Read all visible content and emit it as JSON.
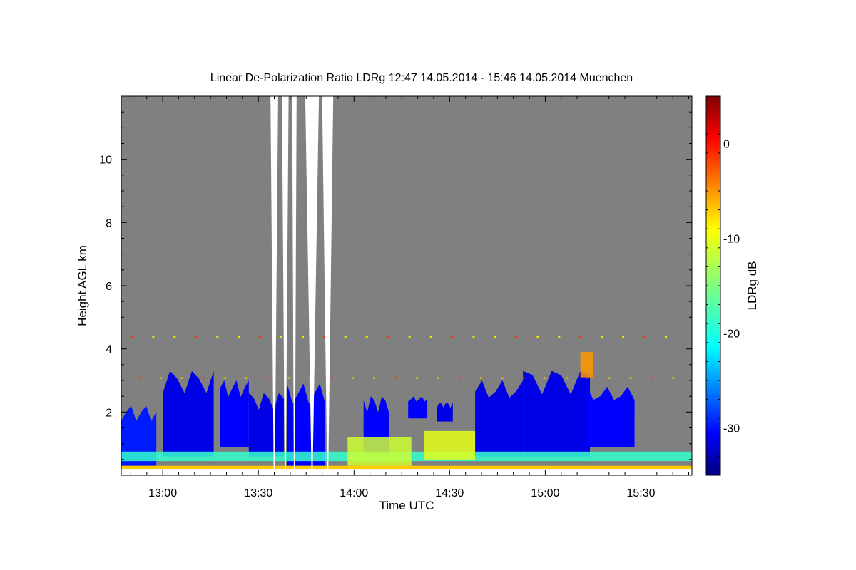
{
  "chart_data": {
    "type": "heatmap",
    "title": "Linear De-Polarization Ratio LDRg   12:47 14.05.2014 - 15:46 14.05.2014 Muenchen",
    "xlabel": "Time UTC",
    "ylabel": "Height AGL km",
    "colorbar_label": "LDRg dB",
    "x_range_minutes": [
      767,
      946
    ],
    "y_range_km": [
      0,
      12
    ],
    "x_ticks": [
      {
        "label": "13:00",
        "value": 780
      },
      {
        "label": "13:30",
        "value": 810
      },
      {
        "label": "14:00",
        "value": 840
      },
      {
        "label": "14:30",
        "value": 870
      },
      {
        "label": "15:00",
        "value": 900
      },
      {
        "label": "15:30",
        "value": 930
      }
    ],
    "y_ticks": [
      {
        "label": "2",
        "value": 2
      },
      {
        "label": "4",
        "value": 4
      },
      {
        "label": "6",
        "value": 6
      },
      {
        "label": "8",
        "value": 8
      },
      {
        "label": "10",
        "value": 10
      }
    ],
    "colorbar_range_db": [
      -35,
      5
    ],
    "colorbar_ticks": [
      {
        "label": "0",
        "value": 0
      },
      {
        "label": "-10",
        "value": -10
      },
      {
        "label": "-20",
        "value": -20
      },
      {
        "label": "-30",
        "value": -30
      }
    ],
    "colormap": "jet",
    "background_color": "#808080",
    "no_data_color": "#ffffff",
    "clouds": [
      {
        "t0": 767,
        "t1": 778,
        "h0": 0.3,
        "h1": 2.2,
        "ldr": -29
      },
      {
        "t0": 780,
        "t1": 796,
        "h0": 0.6,
        "h1": 3.3,
        "ldr": -31
      },
      {
        "t0": 798,
        "t1": 807,
        "h0": 0.9,
        "h1": 3.0,
        "ldr": -30
      },
      {
        "t0": 807,
        "t1": 818,
        "h0": 0.6,
        "h1": 2.6,
        "ldr": -31
      },
      {
        "t0": 819,
        "t1": 831,
        "h0": 0.3,
        "h1": 2.9,
        "ldr": -30
      },
      {
        "t0": 843,
        "t1": 851,
        "h0": 0.6,
        "h1": 2.5,
        "ldr": -30
      },
      {
        "t0": 857,
        "t1": 863,
        "h0": 1.8,
        "h1": 2.5,
        "ldr": -30
      },
      {
        "t0": 866,
        "t1": 871,
        "h0": 1.7,
        "h1": 2.3,
        "ldr": -31
      },
      {
        "t0": 878,
        "t1": 893,
        "h0": 0.6,
        "h1": 3.0,
        "ldr": -31
      },
      {
        "t0": 893,
        "t1": 914,
        "h0": 0.6,
        "h1": 3.3,
        "ldr": -31
      },
      {
        "t0": 913,
        "t1": 928,
        "h0": 0.9,
        "h1": 2.8,
        "ldr": -30
      }
    ],
    "depolarizing_layers": [
      {
        "t0": 767,
        "t1": 946,
        "h0": 0.45,
        "h1": 0.75,
        "ldr": -18
      },
      {
        "t0": 862,
        "t1": 878,
        "h0": 0.5,
        "h1": 1.4,
        "ldr": -11
      },
      {
        "t0": 838,
        "t1": 858,
        "h0": 0.3,
        "h1": 1.2,
        "ldr": -12
      },
      {
        "t0": 911,
        "t1": 915,
        "h0": 3.1,
        "h1": 3.9,
        "ldr": -6
      }
    ],
    "gaps_no_data": [
      {
        "t0": 813.8,
        "t1": 816.2
      },
      {
        "t0": 817.4,
        "t1": 819.5
      },
      {
        "t0": 820.6,
        "t1": 822.0
      },
      {
        "t0": 824.7,
        "t1": 829.0
      },
      {
        "t0": 830.0,
        "t1": 833.5
      }
    ]
  }
}
